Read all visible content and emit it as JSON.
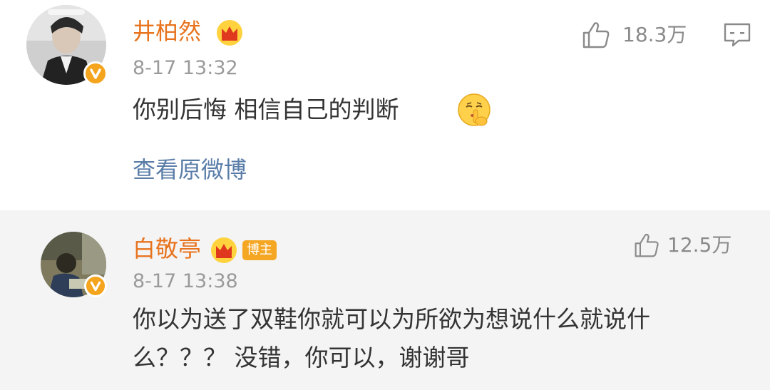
{
  "posts": [
    {
      "author": "井柏然",
      "timestamp": "8-17 13:32",
      "content": "你别后悔 相信自己的判断",
      "emoji": "shush-face-icon",
      "link_label": "查看原微博",
      "likes": "18.3万",
      "verified": true
    },
    {
      "author": "白敬亭",
      "badge": "博主",
      "timestamp": "8-17 13:38",
      "content_line1": "你以为送了双鞋你就可以为所欲为想说什么就说什",
      "content_line2": "么？？？ 没错，你可以，谢谢哥",
      "likes": "12.5万",
      "verified": true
    }
  ],
  "colors": {
    "name": "#e8731e",
    "link": "#5a7da8",
    "badge": "#f5a623",
    "reply_bg": "#f4f4f4"
  }
}
